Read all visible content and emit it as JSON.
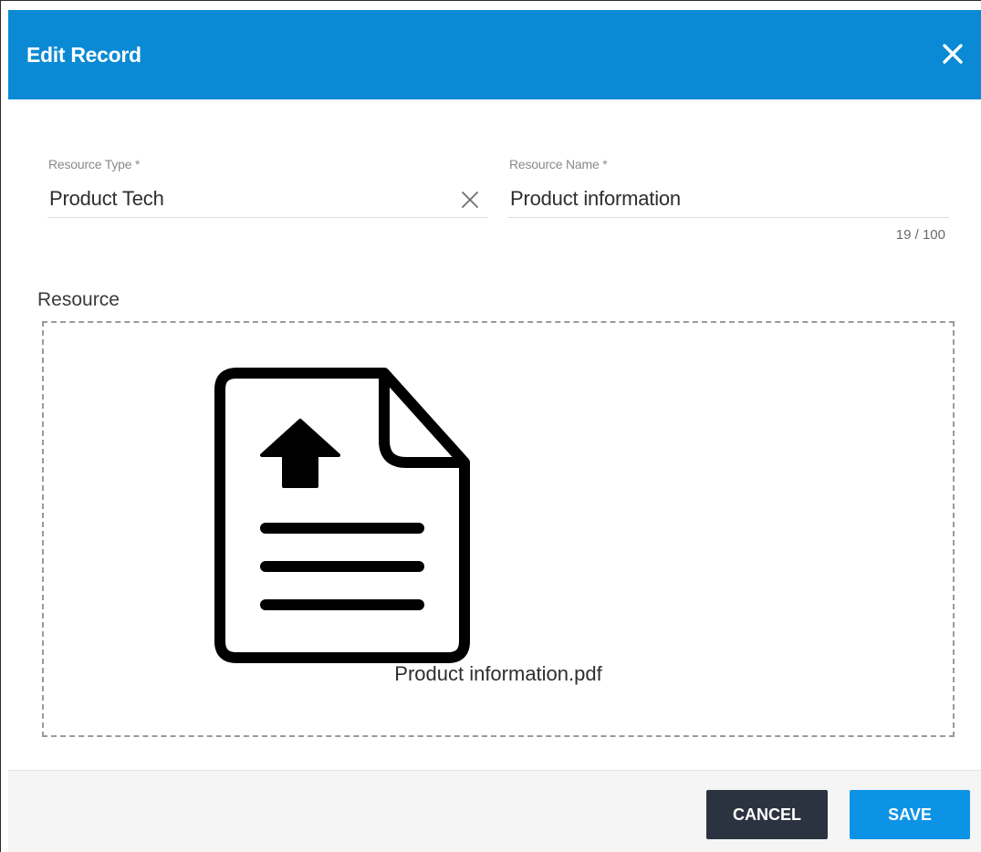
{
  "dialog": {
    "title": "Edit Record",
    "close_icon": "close-icon"
  },
  "fields": {
    "resource_type": {
      "label": "Resource Type *",
      "value": "Product Tech",
      "clear_icon": "clear-icon"
    },
    "resource_name": {
      "label": "Resource Name *",
      "value": "Product information",
      "counter": "19 / 100"
    }
  },
  "resource": {
    "label": "Resource",
    "file_icon": "file-upload-icon",
    "file_name": "Product information.pdf"
  },
  "footer": {
    "cancel_label": "CANCEL",
    "save_label": "SAVE"
  },
  "colors": {
    "header": "#0a8ad4",
    "cancel_button": "#2b3340",
    "save_button": "#0d93e6"
  }
}
